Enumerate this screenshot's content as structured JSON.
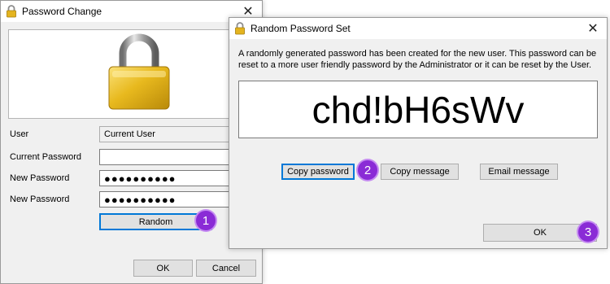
{
  "password_change": {
    "title": "Password Change",
    "user_label": "User",
    "user_value": "Current User",
    "current_password_label": "Current Password",
    "current_password_value": "",
    "new_password_label": "New Password",
    "new_password_value": "●●●●●●●●●●",
    "confirm_password_label": "New Password",
    "confirm_password_value": "●●●●●●●●●●",
    "random_button": "Random",
    "ok_button": "OK",
    "cancel_button": "Cancel"
  },
  "random_dialog": {
    "title": "Random Password Set",
    "message": "A randomly generated password has been created for the new user. This password can be reset to a more user friendly password by the Administrator or it can be reset by the User.",
    "password": "chd!bH6sWv",
    "copy_password_button": "Copy password",
    "copy_message_button": "Copy message",
    "email_message_button": "Email message",
    "ok_button": "OK"
  },
  "callouts": [
    "1",
    "2",
    "3"
  ],
  "colors": {
    "badge": "#8a2bd6",
    "focus": "#0078d7",
    "lock_gold": "#e0b21c"
  },
  "icons": {
    "title_icon": "padlock-icon",
    "close": "close-icon",
    "hero": "padlock-icon"
  }
}
